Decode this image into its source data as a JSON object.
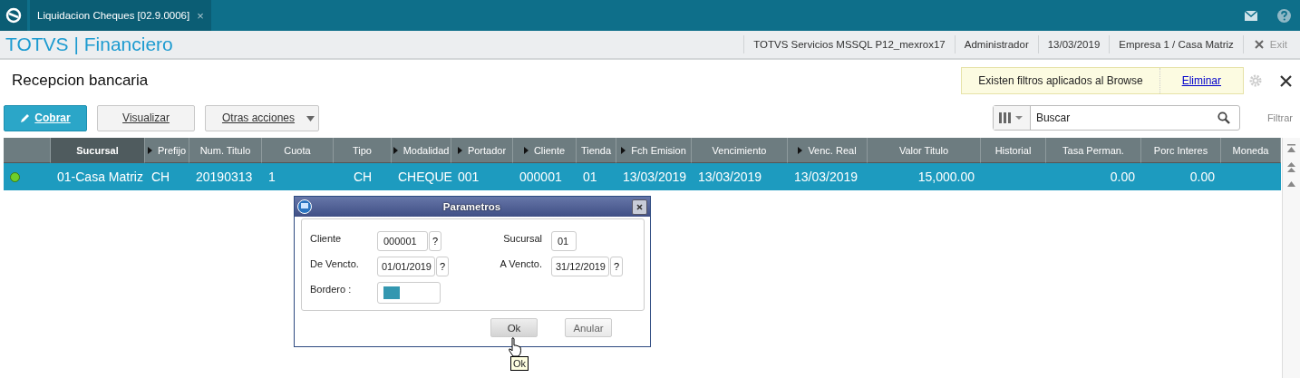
{
  "tab": {
    "title": "Liquidacion Cheques [02.9.0006]",
    "close": "×"
  },
  "header": {
    "brand": "TOTVS | Financiero",
    "info": [
      "TOTVS Servicios MSSQL P12_mexrox17",
      "Administrador",
      "13/03/2019",
      "Empresa 1 / Casa Matriz"
    ],
    "exit": "Exit"
  },
  "page_title": "Recepcion bancaria",
  "filter_notice": {
    "text": "Existen filtros aplicados al Browse",
    "link": "Eliminar"
  },
  "actions": [
    {
      "label": "Cobrar",
      "kind": "primary"
    },
    {
      "label": "Visualizar",
      "kind": "plain"
    },
    {
      "label": "Otras acciones",
      "kind": "menu"
    }
  ],
  "search": {
    "placeholder": "Buscar",
    "filter": "Filtrar"
  },
  "table": {
    "columns": [
      {
        "label": "Sucursal",
        "sorted": true,
        "arrow": false
      },
      {
        "label": "Prefijo",
        "sorted": false,
        "arrow": true
      },
      {
        "label": "Num. Titulo",
        "sorted": false,
        "arrow": false
      },
      {
        "label": "Cuota",
        "sorted": false,
        "arrow": false
      },
      {
        "label": "Tipo",
        "sorted": false,
        "arrow": false
      },
      {
        "label": "Modalidad",
        "sorted": false,
        "arrow": true
      },
      {
        "label": "Portador",
        "sorted": false,
        "arrow": true
      },
      {
        "label": "Cliente",
        "sorted": false,
        "arrow": true
      },
      {
        "label": "Tienda",
        "sorted": false,
        "arrow": false
      },
      {
        "label": "Fch Emision",
        "sorted": false,
        "arrow": true
      },
      {
        "label": "Vencimiento",
        "sorted": false,
        "arrow": false
      },
      {
        "label": "Venc. Real",
        "sorted": false,
        "arrow": true
      },
      {
        "label": "Valor Titulo",
        "sorted": false,
        "arrow": false
      },
      {
        "label": "Historial",
        "sorted": false,
        "arrow": false
      },
      {
        "label": "Tasa Perman.",
        "sorted": false,
        "arrow": false
      },
      {
        "label": "Porc Interes",
        "sorted": false,
        "arrow": false
      },
      {
        "label": "Moneda",
        "sorted": false,
        "arrow": false
      }
    ],
    "rows": [
      {
        "selected": true,
        "color": "#6fcf2a",
        "cells": [
          "01-Casa Matriz",
          "CH",
          "20190313",
          "1",
          "CH",
          "CHEQUE",
          "001",
          "000001",
          "01",
          "13/03/2019",
          "13/03/2019",
          "13/03/2019",
          "15,000.00",
          "",
          "0.00",
          "0.00",
          ""
        ]
      }
    ]
  },
  "dialog": {
    "title": "Parametros",
    "fields": [
      {
        "label": "Cliente",
        "value": "000001",
        "lookup": "?"
      },
      {
        "label": "Sucursal",
        "value": "01"
      },
      {
        "label": "De Vencto.",
        "value": "01/01/2019",
        "lookup": "?"
      },
      {
        "label": "A  Vencto.",
        "value": "31/12/2019",
        "lookup": "?"
      },
      {
        "label": "Bordero :",
        "kind": "color"
      }
    ],
    "buttons": [
      "Ok",
      "Anular"
    ],
    "tooltip": "Ok"
  }
}
